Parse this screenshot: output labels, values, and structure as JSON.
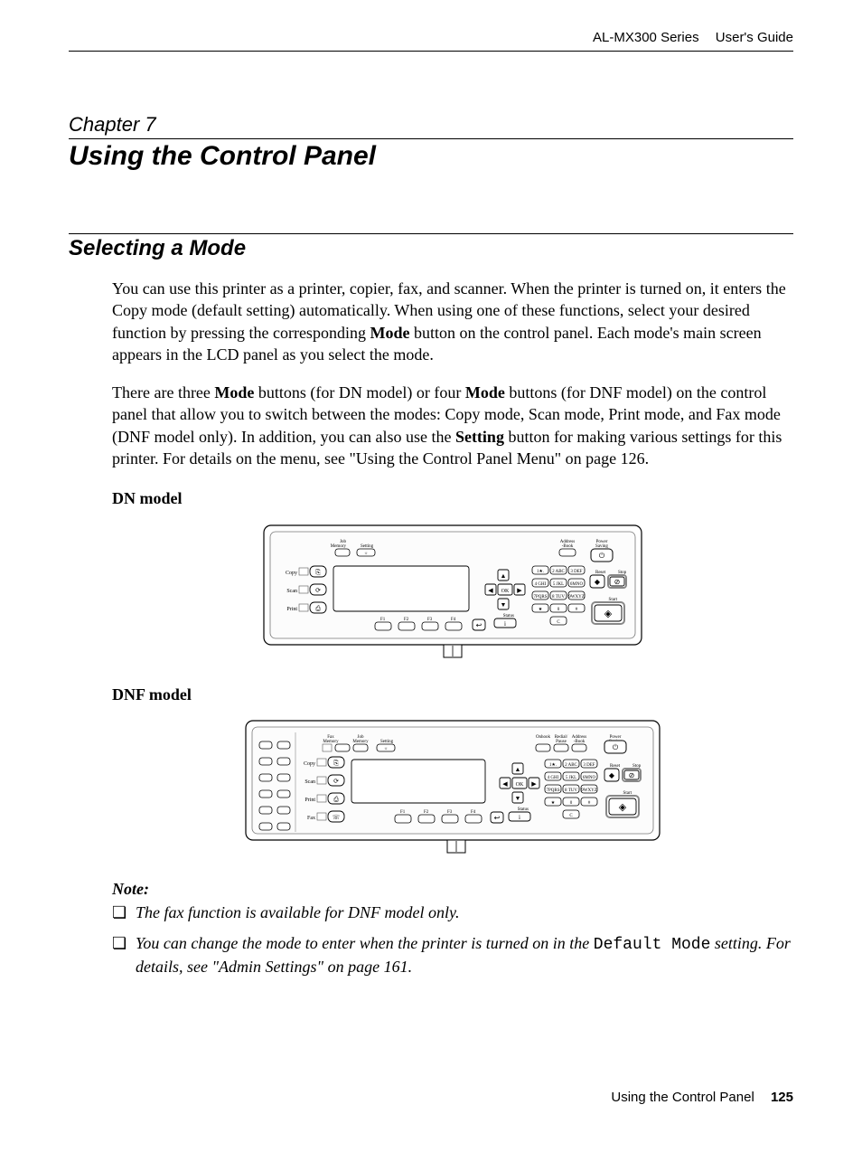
{
  "header": {
    "series": "AL-MX300 Series",
    "guide": "User's Guide"
  },
  "chapter": {
    "label": "Chapter 7",
    "title": "Using the Control Panel"
  },
  "section": {
    "title": "Selecting a Mode",
    "para1_a": "You can use this printer as a printer, copier, fax, and scanner. When the printer is turned on, it enters the Copy mode (default setting) automatically. When using one of these functions, select your desired function by pressing the corresponding ",
    "para1_bold1": "Mode",
    "para1_b": " button on the control panel. Each mode's main screen appears in the LCD panel as you select the mode.",
    "para2_a": "There are three ",
    "para2_bold1": "Mode",
    "para2_b": " buttons (for DN model) or four ",
    "para2_bold2": "Mode",
    "para2_c": " buttons (for DNF model) on the control panel that allow you to switch between the modes: Copy mode, Scan mode, Print mode, and Fax mode (DNF model only). In addition, you can also use the ",
    "para2_bold3": "Setting",
    "para2_d": " button for making various settings for this printer. For details on the menu, see \"Using the Control Panel Menu\" on page 126.",
    "dn_heading": "DN model",
    "dnf_heading": "DNF model"
  },
  "note": {
    "heading": "Note:",
    "item1": "The fax function is available for DNF model only.",
    "item2_a": "You can change the mode to enter when the printer is turned on in the ",
    "item2_mono": "Default Mode",
    "item2_b": " setting. For details, see \"Admin Settings\" on page 161."
  },
  "footer": {
    "text": "Using the Control Panel",
    "page": "125"
  },
  "panel_labels": {
    "job_memory": "Job Memory",
    "setting": "Setting",
    "address_book": "Address Book",
    "power_saving": "Power Saving",
    "copy": "Copy",
    "scan": "Scan",
    "print": "Print",
    "fax": "Fax",
    "reset": "Reset",
    "stop": "Stop",
    "start": "Start",
    "status": "Status",
    "ok": "OK",
    "fax_memory": "Fax Memory",
    "redial_pause": "Redial/Pause",
    "onhook": "Onhook",
    "f1": "F1",
    "f2": "F2",
    "f3": "F3",
    "f4": "F4",
    "key1": "1 ★.",
    "key2": "2 ABC",
    "key3": "3 DEF",
    "key4": "4 GHI",
    "key5": "5 JKL",
    "key6": "6 MNO",
    "key7": "7 PQRS",
    "key8": "8 TUV",
    "key9": "9 WXYZ",
    "keystar": "★",
    "key0": "0",
    "keyhash": "#",
    "keyc": "C"
  }
}
